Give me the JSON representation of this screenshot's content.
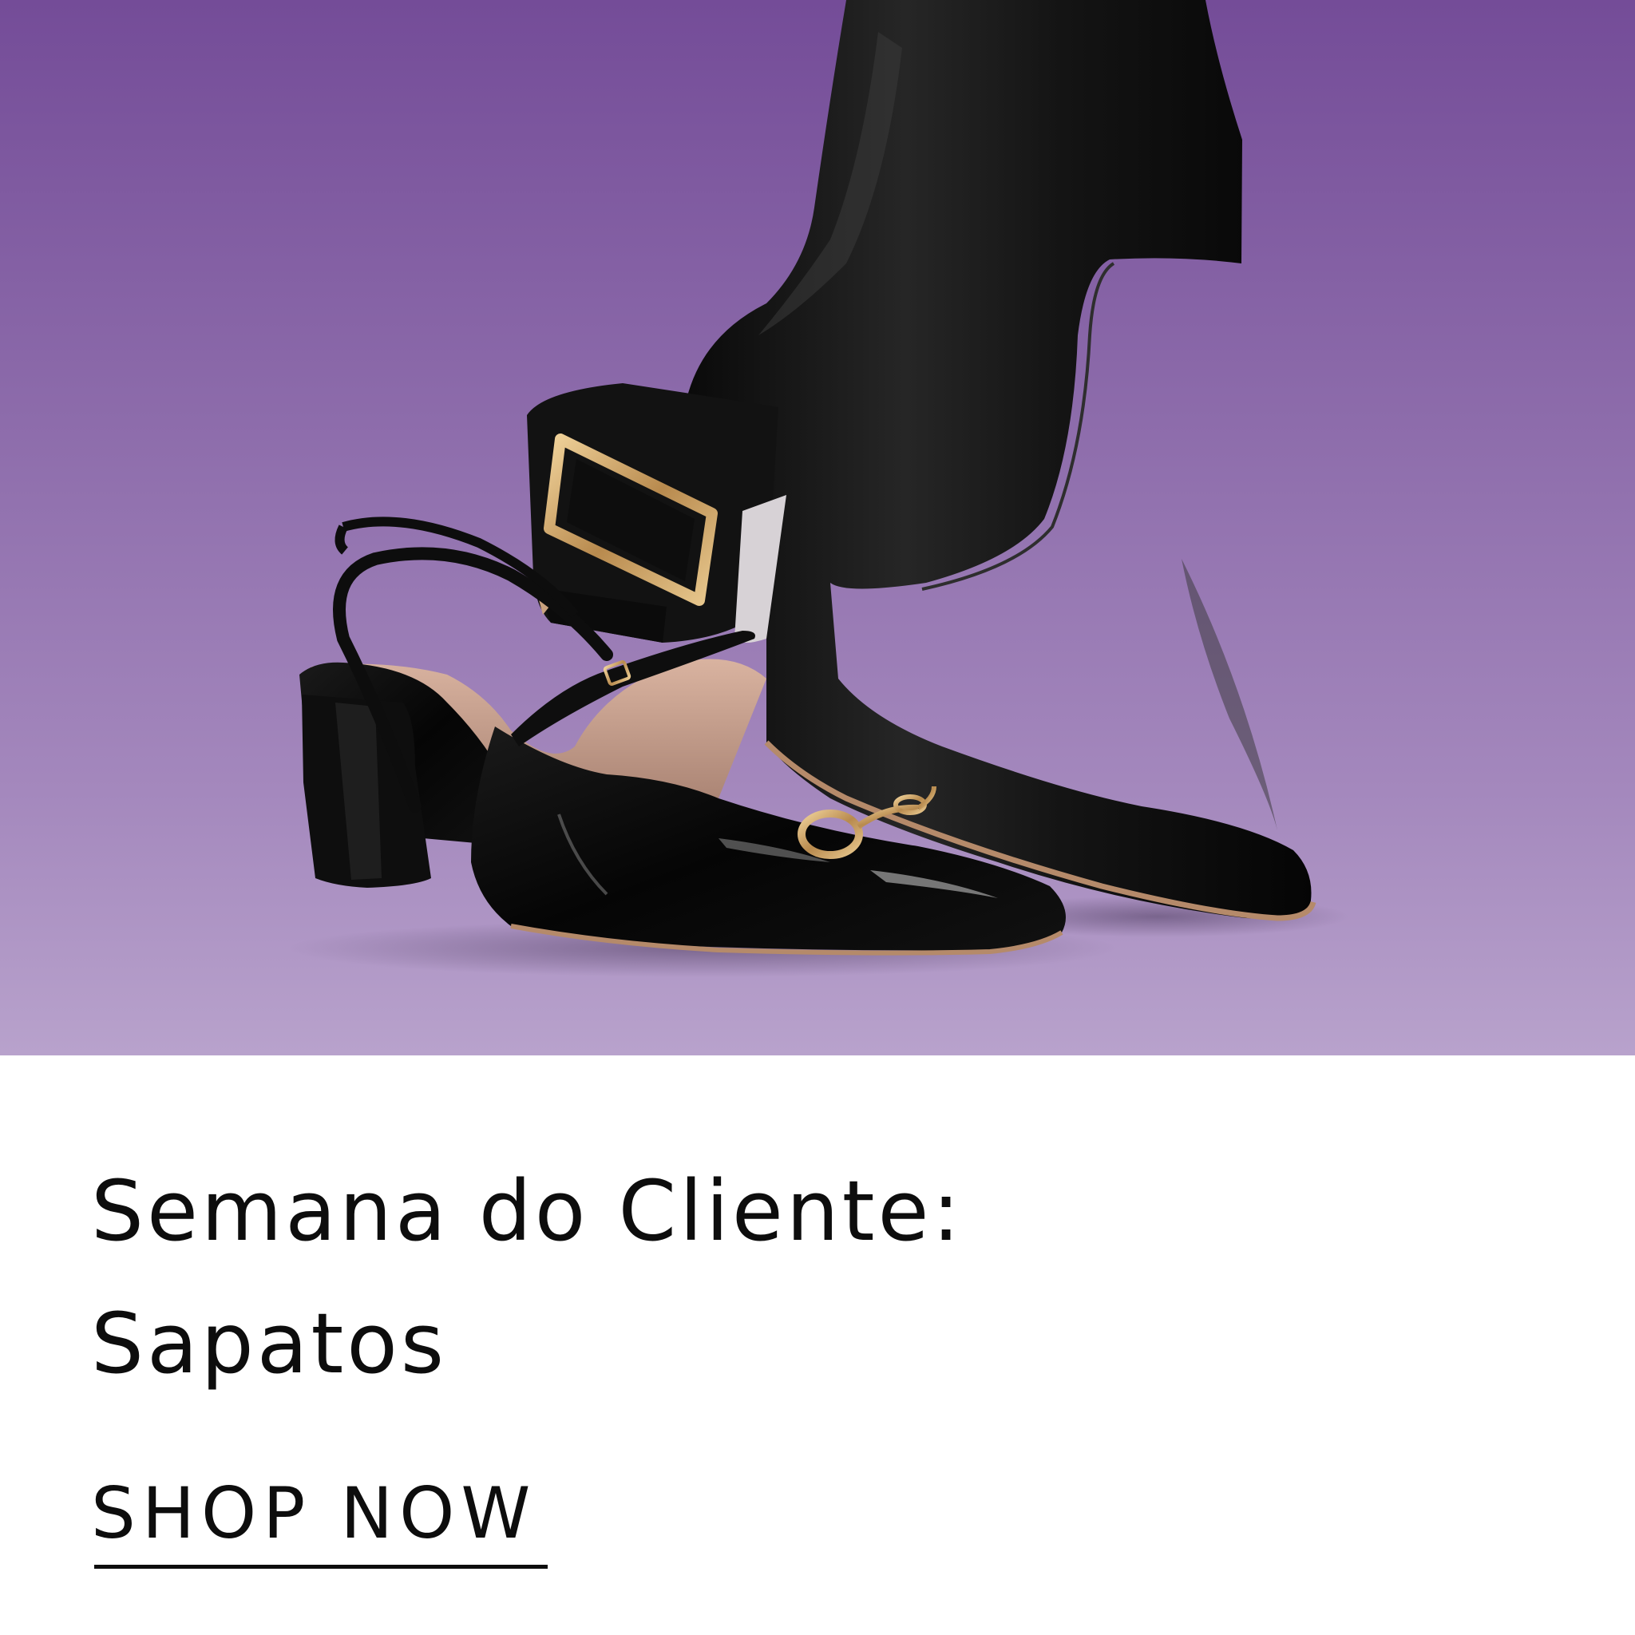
{
  "promo": {
    "headline_line1": "Semana do Cliente:",
    "headline_line2": "Sapatos",
    "cta_label": "SHOP NOW"
  },
  "colors": {
    "hero_top": "#744c98",
    "hero_bottom": "#b8a2cc",
    "text": "#0d0d0d",
    "hardware_gold": "#c9a063"
  }
}
